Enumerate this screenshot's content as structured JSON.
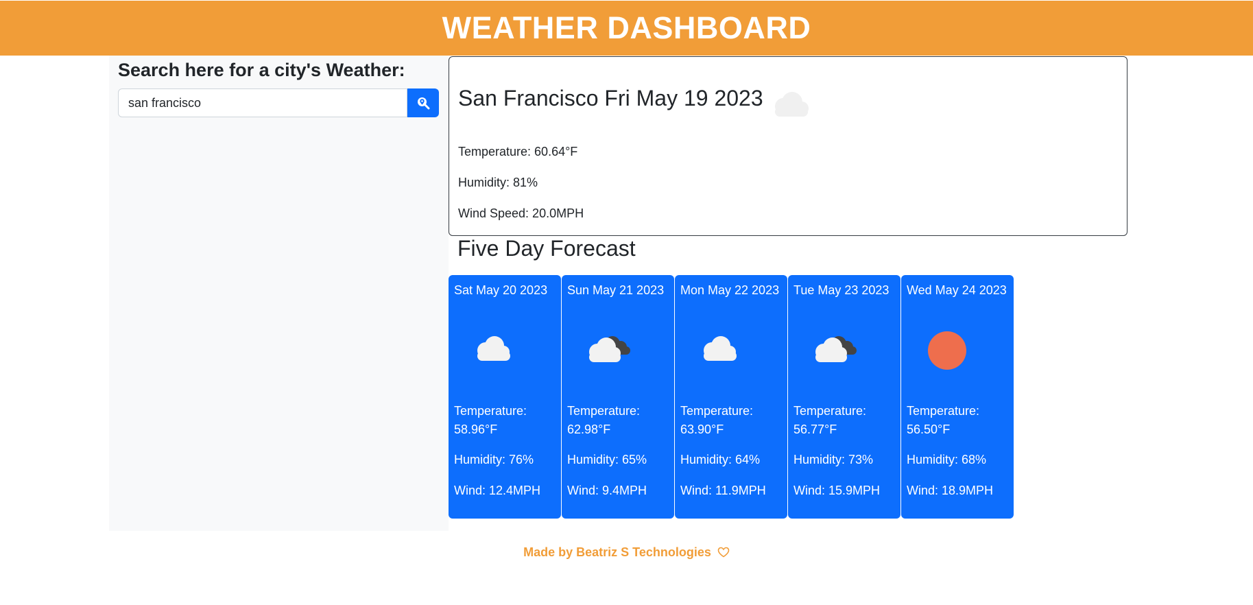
{
  "header": {
    "title": "WEATHER DASHBOARD"
  },
  "search": {
    "title": "Search here for a city's Weather:",
    "value": "san francisco",
    "button_icon": "search-location-icon"
  },
  "current": {
    "title": "San Francisco Fri May 19 2023",
    "icon": "cloud-icon",
    "temperature": "Temperature: 60.64°F",
    "humidity": "Humidity: 81%",
    "wind": "Wind Speed: 20.0MPH"
  },
  "forecast": {
    "title": "Five Day Forecast",
    "days": [
      {
        "date": "Sat May 20 2023",
        "icon": "cloud-icon",
        "temp_label": "Temperature:",
        "temp_value": "58.96°F",
        "humidity": "Humidity: 76%",
        "wind": "Wind: 12.4MPH"
      },
      {
        "date": "Sun May 21 2023",
        "icon": "broken-clouds-icon",
        "temp_label": "Temperature:",
        "temp_value": "62.98°F",
        "humidity": "Humidity: 65%",
        "wind": "Wind: 9.4MPH"
      },
      {
        "date": "Mon May 22 2023",
        "icon": "cloud-icon",
        "temp_label": "Temperature:",
        "temp_value": "63.90°F",
        "humidity": "Humidity: 64%",
        "wind": "Wind: 11.9MPH"
      },
      {
        "date": "Tue May 23 2023",
        "icon": "broken-clouds-icon",
        "temp_label": "Temperature:",
        "temp_value": "56.77°F",
        "humidity": "Humidity: 73%",
        "wind": "Wind: 15.9MPH"
      },
      {
        "date": "Wed May 24 2023",
        "icon": "sun-icon",
        "temp_label": "Temperature:",
        "temp_value": "56.50°F",
        "humidity": "Humidity: 68%",
        "wind": "Wind: 18.9MPH"
      }
    ]
  },
  "footer": {
    "text": "Made by Beatriz S Technologies",
    "icon": "heart-icon"
  },
  "colors": {
    "header_bg": "#f19d38",
    "card_bg": "#0d6efd",
    "sidebar_bg": "#f8f9fa",
    "sun": "#ee6e4d",
    "footer_text": "#f19d38"
  }
}
